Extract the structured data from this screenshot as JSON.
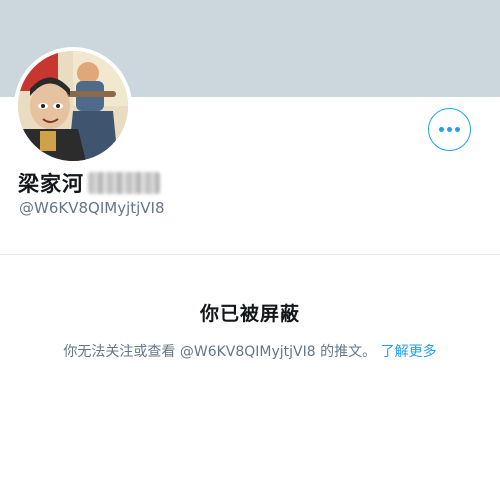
{
  "profile": {
    "display_name": "梁家河",
    "handle": "@W6KV8QIMyjtjVI8"
  },
  "actions": {
    "more_icon": "more-horizontal-icon"
  },
  "blocked": {
    "title": "你已被屏蔽",
    "description_prefix": "你无法关注或查看 @W6KV8QIMyjtjVI8 的推文。",
    "learn_more": "了解更多"
  },
  "colors": {
    "accent": "#1da1f2",
    "banner": "#ccd6dd",
    "secondary_text": "#657786"
  }
}
